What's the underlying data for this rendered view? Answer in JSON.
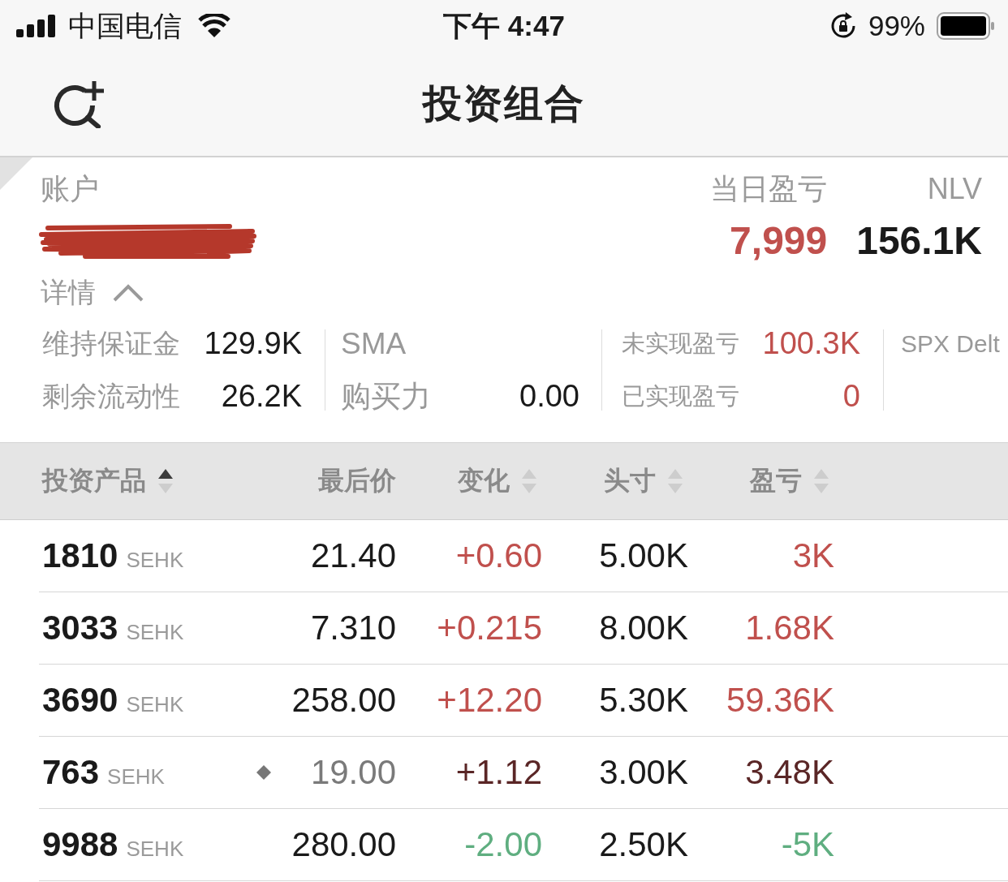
{
  "status_bar": {
    "carrier": "中国电信",
    "time": "下午 4:47",
    "battery": "99%"
  },
  "nav_bar": {
    "title": "投资组合"
  },
  "account": {
    "label": "账户",
    "daily_pnl": {
      "label": "当日盈亏",
      "value": "7,999",
      "color": "#c0504d"
    },
    "nlv": {
      "label": "NLV",
      "value": "156.1K",
      "color": "#1a1a1a"
    },
    "details": {
      "label": "详情",
      "expanded": true
    }
  },
  "metrics": [
    {
      "rows": [
        {
          "label": "维持保证金",
          "value": "129.9K",
          "color": "#1a1a1a"
        },
        {
          "label": "剩余流动性",
          "value": "26.2K",
          "color": "#1a1a1a"
        }
      ]
    },
    {
      "rows": [
        {
          "label": "SMA"
        },
        {
          "label": "购买力",
          "value": "0.00",
          "color": "#1a1a1a"
        }
      ]
    },
    {
      "rows": [
        {
          "label": "未实现盈亏",
          "value": "100.3K",
          "color": "#c0504d"
        },
        {
          "label": "已实现盈亏",
          "value": "0",
          "color": "#c0504d"
        }
      ]
    },
    {
      "rows": [
        {
          "label": "SPX Delt"
        }
      ]
    }
  ],
  "table": {
    "columns": [
      {
        "label": "投资产品",
        "sortable": true,
        "selected": true
      },
      {
        "label": "最后价",
        "sortable": false,
        "selected": false
      },
      {
        "label": "变化",
        "sortable": true,
        "selected": false
      },
      {
        "label": "头寸",
        "sortable": true,
        "selected": false
      },
      {
        "label": "盈亏",
        "sortable": true,
        "selected": false
      }
    ],
    "rows": [
      {
        "symbol": "1810",
        "exchange": "SEHK",
        "marked": false,
        "last_price": "21.40",
        "change": {
          "text": "+0.60",
          "color": "#c0504d"
        },
        "position": "5.00K",
        "pnl": {
          "text": "3K",
          "color": "#c0504d"
        }
      },
      {
        "symbol": "3033",
        "exchange": "SEHK",
        "marked": false,
        "last_price": "7.310",
        "change": {
          "text": "+0.215",
          "color": "#c0504d"
        },
        "position": "8.00K",
        "pnl": {
          "text": "1.68K",
          "color": "#c0504d"
        }
      },
      {
        "symbol": "3690",
        "exchange": "SEHK",
        "marked": false,
        "last_price": "258.00",
        "change": {
          "text": "+12.20",
          "color": "#c0504d"
        },
        "position": "5.30K",
        "pnl": {
          "text": "59.36K",
          "color": "#c0504d"
        }
      },
      {
        "symbol": "763",
        "exchange": "SEHK",
        "marked": true,
        "last_price": "19.00",
        "change": {
          "text": "+1.12",
          "color": "#5a2626"
        },
        "position": "3.00K",
        "pnl": {
          "text": "3.48K",
          "color": "#5a2626"
        }
      },
      {
        "symbol": "9988",
        "exchange": "SEHK",
        "marked": false,
        "last_price": "280.00",
        "change": {
          "text": "-2.00",
          "color": "#5fae80"
        },
        "position": "2.50K",
        "pnl": {
          "text": "-5K",
          "color": "#5fae80"
        }
      }
    ]
  }
}
